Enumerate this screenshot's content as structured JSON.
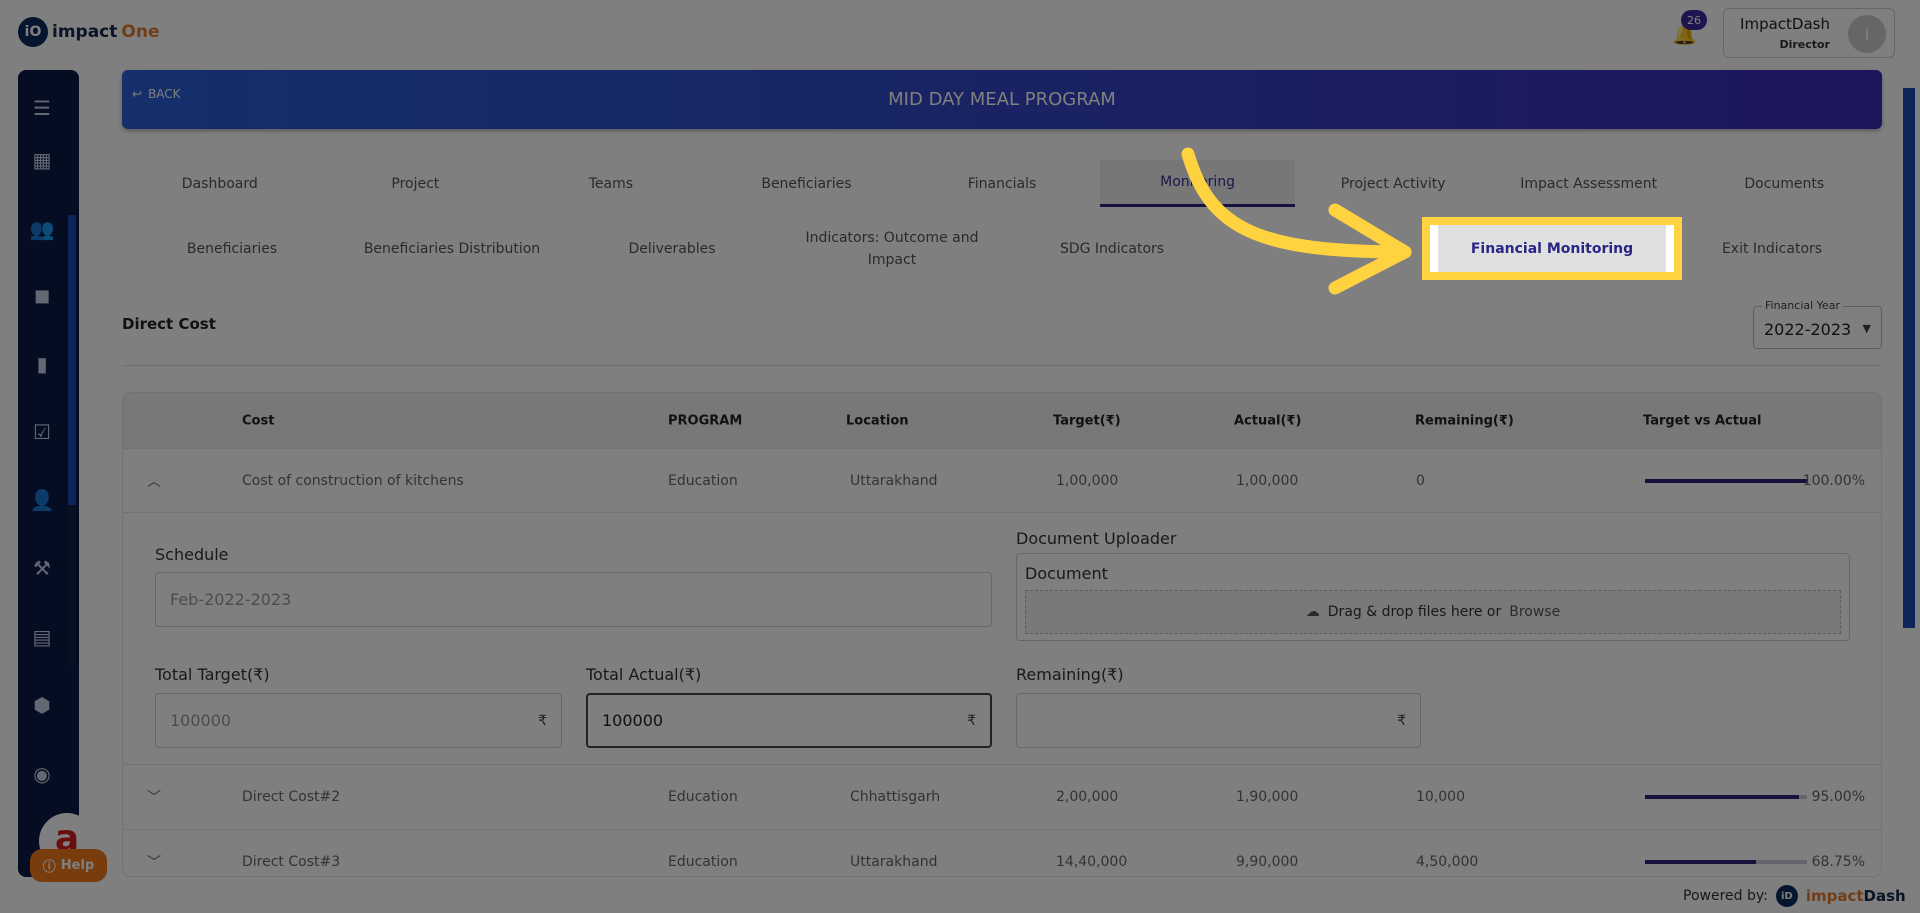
{
  "brand": {
    "logo_mark": "iO",
    "logo_a": "impact",
    "logo_b": "One"
  },
  "notifications": {
    "count": "26"
  },
  "user": {
    "name": "ImpactDash",
    "role": "Director",
    "initial": "I"
  },
  "sidebar": {
    "icons": [
      "menu-icon",
      "dashboard-icon",
      "group-icon",
      "folder-icon",
      "book-icon",
      "checkbox-icon",
      "person-icon",
      "gavel-icon",
      "document-icon",
      "alert-icon",
      "network-icon"
    ],
    "help": "Help",
    "avatar_letter": "a"
  },
  "banner": {
    "back": "BACK",
    "title": "MID DAY MEAL PROGRAM"
  },
  "tabs": [
    "Dashboard",
    "Project",
    "Teams",
    "Beneficiaries",
    "Financials",
    "Monitoring",
    "Project Activity",
    "Impact Assessment",
    "Documents"
  ],
  "subtabs": [
    "Beneficiaries",
    "Beneficiaries Distribution",
    "Deliverables",
    "Indicators: Outcome and Impact",
    "SDG Indicators",
    "",
    "Financial Monitoring",
    "Exit Indicators"
  ],
  "section": {
    "title": "Direct Cost",
    "fy_label": "Financial Year",
    "fy_value": "2022-2023"
  },
  "table": {
    "headers": [
      "Cost",
      "PROGRAM",
      "Location",
      "Target(₹)",
      "Actual(₹)",
      "Remaining(₹)",
      "Target vs Actual"
    ],
    "rows": [
      {
        "cost": "Cost of construction of kitchens",
        "program": "Education",
        "location": "Uttarakhand",
        "target": "1,00,000",
        "actual": "1,00,000",
        "remaining": "0",
        "pct": "100.00%",
        "fill": 100
      },
      {
        "cost": "Direct Cost#2",
        "program": "Education",
        "location": "Chhattisgarh",
        "target": "2,00,000",
        "actual": "1,90,000",
        "remaining": "10,000",
        "pct": "95.00%",
        "fill": 95
      },
      {
        "cost": "Direct Cost#3",
        "program": "Education",
        "location": "Uttarakhand",
        "target": "14,40,000",
        "actual": "9,90,000",
        "remaining": "4,50,000",
        "pct": "68.75%",
        "fill": 68.75
      }
    ]
  },
  "detail": {
    "schedule_label": "Schedule",
    "schedule_value": "Feb-2022-2023",
    "doc_uploader": "Document Uploader",
    "document": "Document",
    "drop_text": "Drag & drop files here or",
    "browse": "Browse",
    "total_target_label": "Total Target(₹)",
    "total_target": "100000",
    "total_actual_label": "Total Actual(₹)",
    "total_actual": "100000",
    "remaining_label": "Remaining(₹)",
    "remaining": "",
    "rupee": "₹"
  },
  "footer": {
    "powered": "Powered by:",
    "logo_mark": "iD",
    "logo_a": "impact",
    "logo_b": "Dash"
  }
}
